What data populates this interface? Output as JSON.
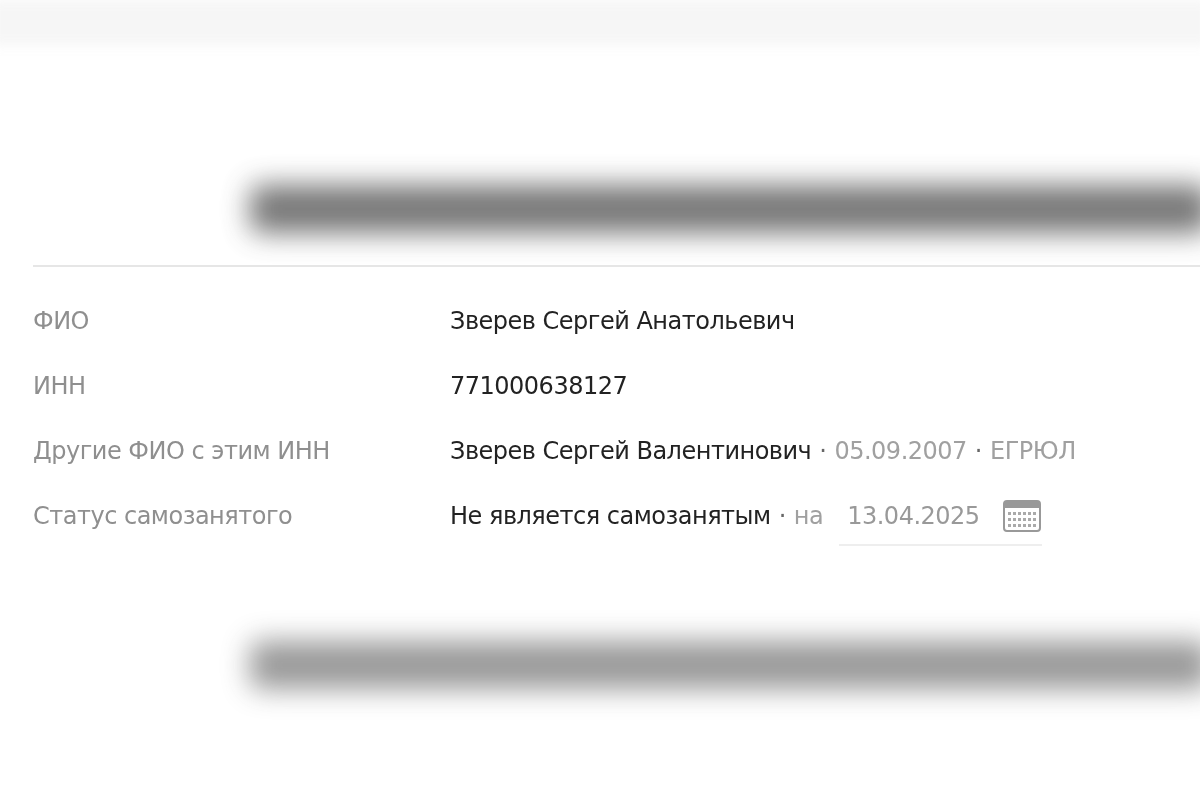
{
  "rows": [
    {
      "label": "ФИО",
      "parts": [
        {
          "kind": "main",
          "text": "Зверев Сергей Анатольевич"
        }
      ]
    },
    {
      "label": "ИНН",
      "parts": [
        {
          "kind": "main",
          "text": "771000638127"
        }
      ]
    },
    {
      "label": "Другие ФИО с этим ИНН",
      "parts": [
        {
          "kind": "main",
          "text": "Зверев Сергей Валентинович"
        },
        {
          "kind": "sep",
          "text": "·"
        },
        {
          "kind": "muted",
          "text": "05.09.2007"
        },
        {
          "kind": "sep",
          "text": "·"
        },
        {
          "kind": "muted",
          "text": "ЕГРЮЛ"
        }
      ]
    },
    {
      "label": "Статус самозанятого",
      "parts": [
        {
          "kind": "main",
          "text": "Не является самозанятым"
        },
        {
          "kind": "sep",
          "text": "·"
        },
        {
          "kind": "muted",
          "text": "на"
        }
      ],
      "date_field": {
        "value": "13.04.2025"
      }
    }
  ]
}
